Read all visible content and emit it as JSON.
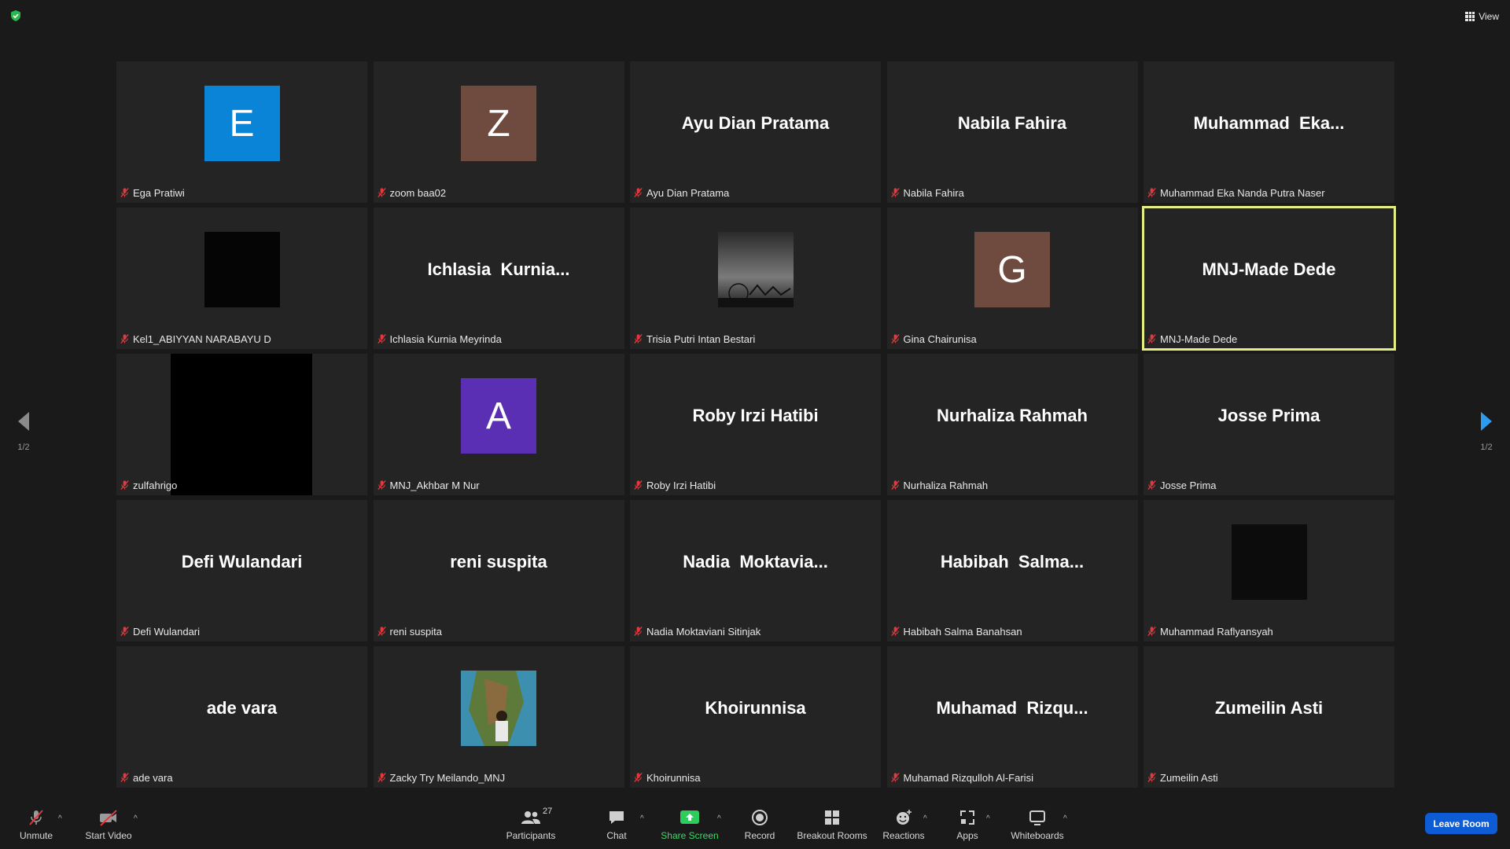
{
  "top": {
    "view_label": "View"
  },
  "nav": {
    "page_indicator": "1/2"
  },
  "tiles": [
    {
      "center_type": "avatar",
      "center": "E",
      "color": "#0a84d6",
      "label": "Ega Pratiwi"
    },
    {
      "center_type": "avatar",
      "center": "Z",
      "color": "#6e4a3f",
      "label": "zoom baa02"
    },
    {
      "center_type": "name",
      "center": "Ayu Dian Pratama",
      "label": "Ayu Dian Pratama"
    },
    {
      "center_type": "name",
      "center": "Nabila Fahira",
      "label": "Nabila Fahira"
    },
    {
      "center_type": "name",
      "center": "Muhammad  Eka...",
      "label": "Muhammad Eka Nanda Putra Naser"
    },
    {
      "center_type": "black-square",
      "center": "",
      "label": "Kel1_ABIYYAN NARABAYU D"
    },
    {
      "center_type": "name",
      "center": "Ichlasia  Kurnia...",
      "label": "Ichlasia Kurnia Meyrinda"
    },
    {
      "center_type": "photo-night",
      "center": "",
      "label": "Trisia Putri Intan Bestari"
    },
    {
      "center_type": "avatar",
      "center": "G",
      "color": "#6e4a3f",
      "label": "Gina Chairunisa"
    },
    {
      "center_type": "name",
      "center": "MNJ-Made Dede",
      "label": "MNJ-Made Dede",
      "active": true
    },
    {
      "center_type": "video-black",
      "center": "",
      "label": "zulfahrigo"
    },
    {
      "center_type": "avatar",
      "center": "A",
      "color": "#5b2fb3",
      "label": "MNJ_Akhbar M Nur"
    },
    {
      "center_type": "name",
      "center": "Roby Irzi Hatibi",
      "label": "Roby Irzi Hatibi"
    },
    {
      "center_type": "name",
      "center": "Nurhaliza Rahmah",
      "label": "Nurhaliza Rahmah"
    },
    {
      "center_type": "name",
      "center": "Josse Prima",
      "label": "Josse Prima"
    },
    {
      "center_type": "name",
      "center": "Defi Wulandari",
      "label": "Defi Wulandari"
    },
    {
      "center_type": "name",
      "center": "reni suspita",
      "label": "reni suspita"
    },
    {
      "center_type": "name",
      "center": "Nadia  Moktavia...",
      "label": "Nadia Moktaviani Sitinjak"
    },
    {
      "center_type": "name",
      "center": "Habibah  Salma...",
      "label": "Habibah Salma Banahsan"
    },
    {
      "center_type": "photo-dark",
      "center": "",
      "label": "Muhammad Raflyansyah"
    },
    {
      "center_type": "name",
      "center": "ade vara",
      "label": "ade vara"
    },
    {
      "center_type": "photo-cliff",
      "center": "",
      "label": "Zacky Try Meilando_MNJ"
    },
    {
      "center_type": "name",
      "center": "Khoirunnisa",
      "label": "Khoirunnisa"
    },
    {
      "center_type": "name",
      "center": "Muhamad  Rizqu...",
      "label": "Muhamad Rizqulloh Al-Farisi"
    },
    {
      "center_type": "name",
      "center": "Zumeilin Asti",
      "label": "Zumeilin Asti"
    }
  ],
  "toolbar": {
    "unmute": "Unmute",
    "start_video": "Start Video",
    "participants": "Participants",
    "participants_count": "27",
    "chat": "Chat",
    "share_screen": "Share Screen",
    "record": "Record",
    "breakout_rooms": "Breakout Rooms",
    "reactions": "Reactions",
    "apps": "Apps",
    "whiteboards": "Whiteboards",
    "leave": "Leave Room"
  },
  "colors": {
    "background": "#1a1a1a",
    "tile": "#242424",
    "active_speaker": "#e5ee83",
    "share_green": "#3fd86b",
    "leave_blue": "#0e5bd6",
    "muted_red": "#e0393e"
  }
}
